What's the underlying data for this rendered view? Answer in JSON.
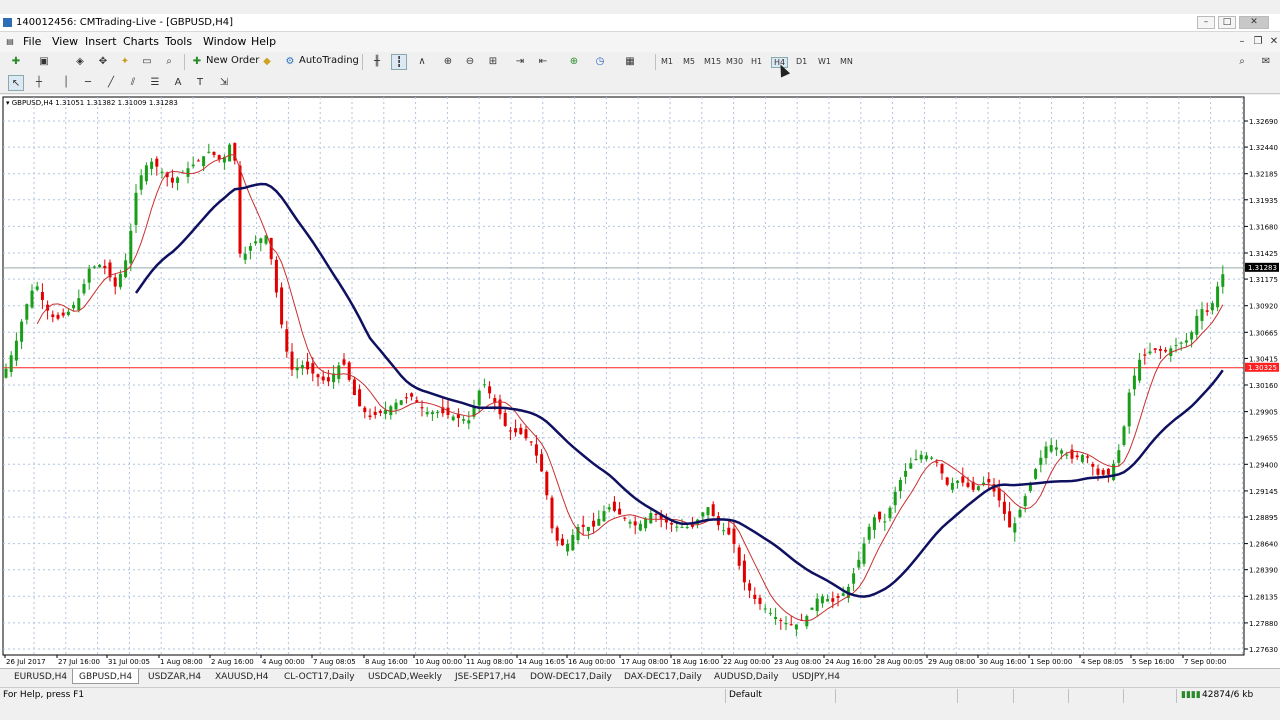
{
  "window": {
    "title": "140012456: CMTrading-Live - [GBPUSD,H4]"
  },
  "menu": [
    "File",
    "View",
    "Insert",
    "Charts",
    "Tools",
    "Window",
    "Help"
  ],
  "toolbar": {
    "new_order": "New Order",
    "autotrading": "AutoTrading",
    "timeframes": [
      "M1",
      "M5",
      "M15",
      "M30",
      "H1",
      "H4",
      "D1",
      "W1",
      "MN"
    ]
  },
  "chart": {
    "info": "GBPUSD,H4  1.31051 1.31382 1.31009 1.31283",
    "prices": [
      "1.32690",
      "1.32440",
      "1.32185",
      "1.31935",
      "1.31680",
      "1.31425",
      "1.31175",
      "1.30920",
      "1.30665",
      "1.30415",
      "1.30160",
      "1.29905",
      "1.29655",
      "1.29400",
      "1.29145",
      "1.28895",
      "1.28640",
      "1.28390",
      "1.28135",
      "1.27880",
      "1.27630"
    ],
    "current_price": "1.31283",
    "red_line_price": "1.30325",
    "dates": [
      "26 Jul 2017",
      "27 Jul 16:00",
      "31 Jul 00:05",
      "1 Aug 08:00",
      "2 Aug 16:00",
      "4 Aug 00:00",
      "7 Aug 08:05",
      "8 Aug 16:00",
      "10 Aug 00:00",
      "11 Aug 08:00",
      "14 Aug 16:05",
      "16 Aug 00:00",
      "17 Aug 08:00",
      "18 Aug 16:00",
      "22 Aug 00:00",
      "23 Aug 08:00",
      "24 Aug 16:00",
      "28 Aug 00:05",
      "29 Aug 08:00",
      "30 Aug 16:00",
      "1 Sep 00:00",
      "4 Sep 08:05",
      "5 Sep 16:00",
      "7 Sep 00:00"
    ],
    "colors": {
      "bull": "#1a9e1a",
      "bear": "#e00000",
      "ma_slow": "#101060",
      "ma_fast": "#c83030",
      "grid": "#b0c4de"
    }
  },
  "tabs": [
    "EURUSD,H4",
    "GBPUSD,H4",
    "USDZAR,H4",
    "XAUUSD,H4",
    "CL-OCT17,Daily",
    "USDCAD,Weekly",
    "JSE-SEP17,H4",
    "DOW-DEC17,Daily",
    "DAX-DEC17,Daily",
    "AUDUSD,Daily",
    "USDJPY,H4"
  ],
  "active_tab": "GBPUSD,H4",
  "status": {
    "help": "For Help, press F1",
    "profile": "Default",
    "traffic": "42874/6 kb"
  }
}
